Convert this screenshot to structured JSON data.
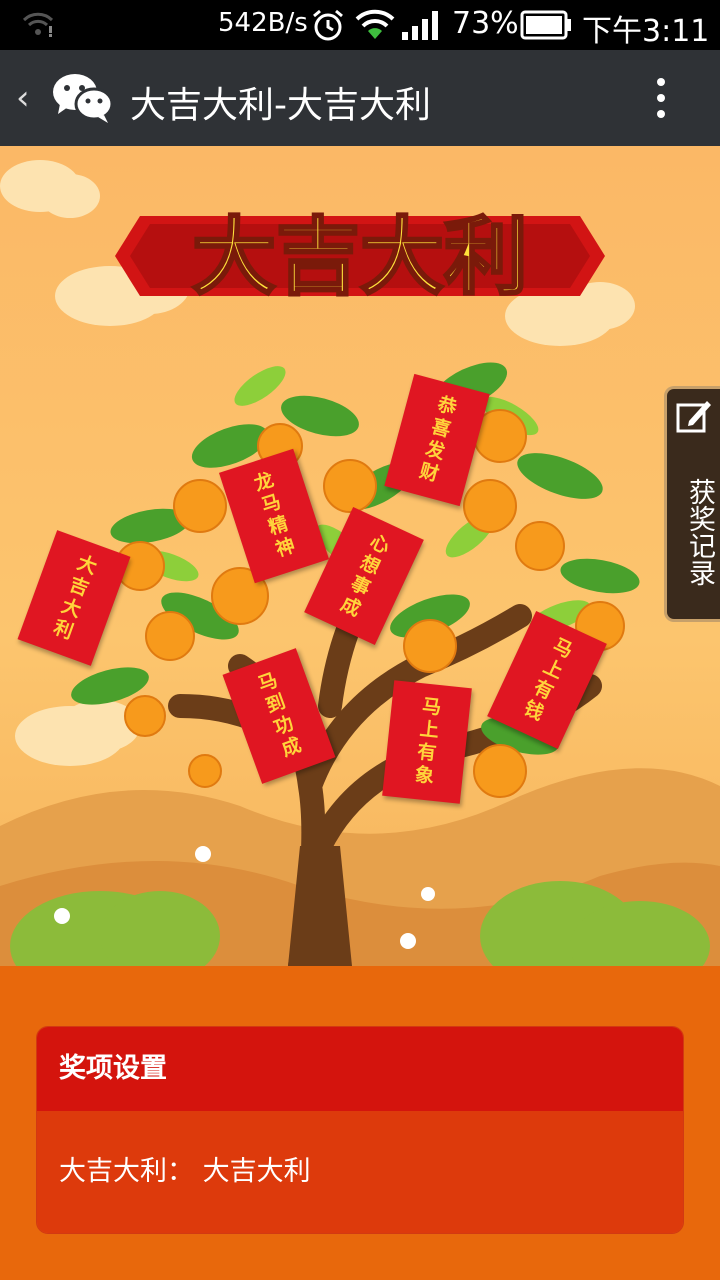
{
  "status_bar": {
    "net_speed": "542B/s",
    "battery_percent": "73%",
    "time": "下午3:11",
    "icons": [
      "wifi-alert-icon",
      "alarm-icon",
      "wifi-icon",
      "signal-icon",
      "battery-icon"
    ]
  },
  "title_bar": {
    "back_symbol": "‹",
    "title": "大吉大利-大吉大利",
    "icons": [
      "back-icon",
      "wechat-icon",
      "more-icon"
    ]
  },
  "banner": {
    "headline": "大吉大利",
    "hongbao": [
      "大吉大利",
      "龙马精神",
      "恭喜发财",
      "心想事成",
      "马到功成",
      "马上有象",
      "马上有钱"
    ]
  },
  "side_tab": {
    "label": "获奖记录",
    "icon": "edit-icon"
  },
  "prize_panel": {
    "heading": "奖项设置",
    "item": "大吉大利： 大吉大利"
  },
  "colors": {
    "status_bar": "#000000",
    "title_bar": "#2f3236",
    "page_bg": "#e8680c",
    "panel_head": "#d4140d",
    "panel_body": "#dd3a0c",
    "hongbao": "#e01622",
    "hongbao_text": "#ffd43b"
  }
}
